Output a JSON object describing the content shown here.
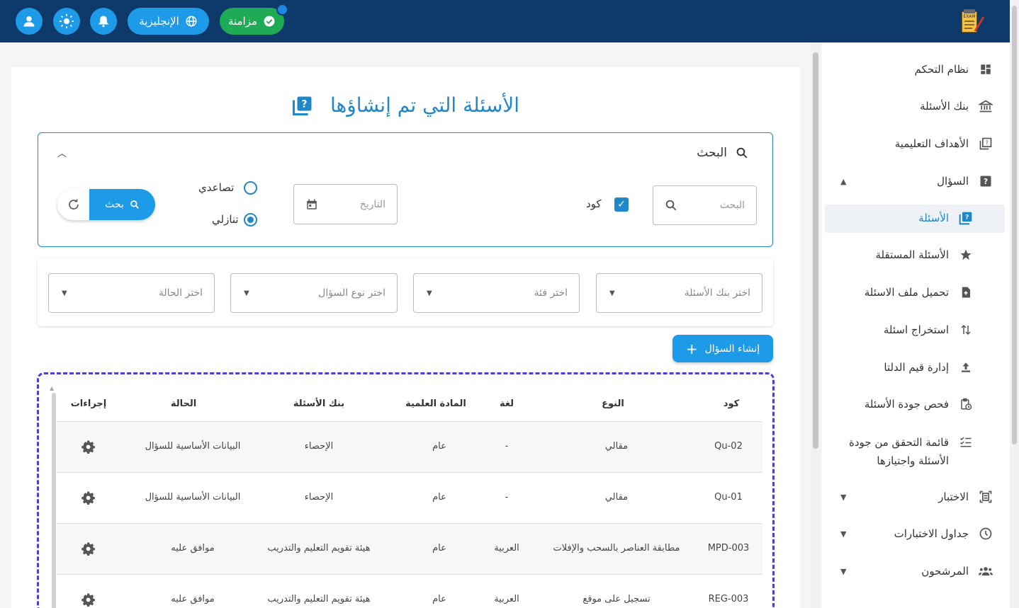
{
  "topbar": {
    "language_label": "الإنجليزية",
    "sync_label": "مزامنة",
    "logo_text": "EXAM"
  },
  "sidebar": {
    "items": [
      {
        "label": "نظام التحكم",
        "icon": "dashboard-icon"
      },
      {
        "label": "بنك الأسئلة",
        "icon": "bank-icon"
      },
      {
        "label": "الأهداف التعليمية",
        "icon": "objectives-icon"
      },
      {
        "label": "السؤال",
        "icon": "question-icon"
      },
      {
        "label": "الأسئلة",
        "icon": "questions-icon"
      },
      {
        "label": "الأسئلة المستقلة",
        "icon": "star-icon"
      },
      {
        "label": "تحميل ملف الاسئلة",
        "icon": "upload-file-icon"
      },
      {
        "label": "استخراج اسئلة",
        "icon": "sort-icon"
      },
      {
        "label": "إدارة قيم الدلتا",
        "icon": "upload-icon"
      },
      {
        "label": "فحص جودة الأسئلة",
        "icon": "clipboard-clock-icon"
      },
      {
        "label": "قائمة التحقق من جودة الأسئلة واجتيازها",
        "icon": "checklist-icon"
      },
      {
        "label": "الاختبار",
        "icon": "exam-icon"
      },
      {
        "label": "جداول الاختبارات",
        "icon": "clock-icon"
      },
      {
        "label": "المرشحون",
        "icon": "people-icon"
      }
    ]
  },
  "page": {
    "title": "الأسئلة التي تم إنشاؤها"
  },
  "search": {
    "heading": "البحث",
    "search_placeholder": "البحث",
    "code_label": "كود",
    "date_placeholder": "التاريخ",
    "ascending_label": "تصاعدي",
    "descending_label": "تنازلي",
    "search_button": "بحث"
  },
  "filters": {
    "bank_placeholder": "اختر بنك الأسئلة",
    "category_placeholder": "اختر فئة",
    "type_placeholder": "اختر نوع السؤال",
    "status_placeholder": "اختر الحالة"
  },
  "create_button": "إنشاء السؤال",
  "table": {
    "headers": {
      "code": "كود",
      "type": "النوع",
      "language": "لغة",
      "subject": "المادة العلمية",
      "bank": "بنك الأسئلة",
      "status": "الحالة",
      "actions": "إجراءات"
    },
    "rows": [
      {
        "code": "Qu-02",
        "type": "مقالي",
        "language": "-",
        "subject": "عام",
        "bank": "الإحصاء",
        "status": "البيانات الأساسية للسؤال"
      },
      {
        "code": "Qu-01",
        "type": "مقالي",
        "language": "-",
        "subject": "عام",
        "bank": "الإحصاء",
        "status": "البيانات الأساسية للسؤال"
      },
      {
        "code": "MPD-003",
        "type": "مطابقة العناصر بالسحب والإفلات",
        "language": "العربية",
        "subject": "عام",
        "bank": "هيئة تقويم التعليم والتدريب",
        "status": "موافق عليه"
      },
      {
        "code": "REG-003",
        "type": "تسجيل على موقع",
        "language": "العربية",
        "subject": "عام",
        "bank": "هيئة تقويم التعليم والتدريب",
        "status": "موافق عليه"
      }
    ]
  }
}
